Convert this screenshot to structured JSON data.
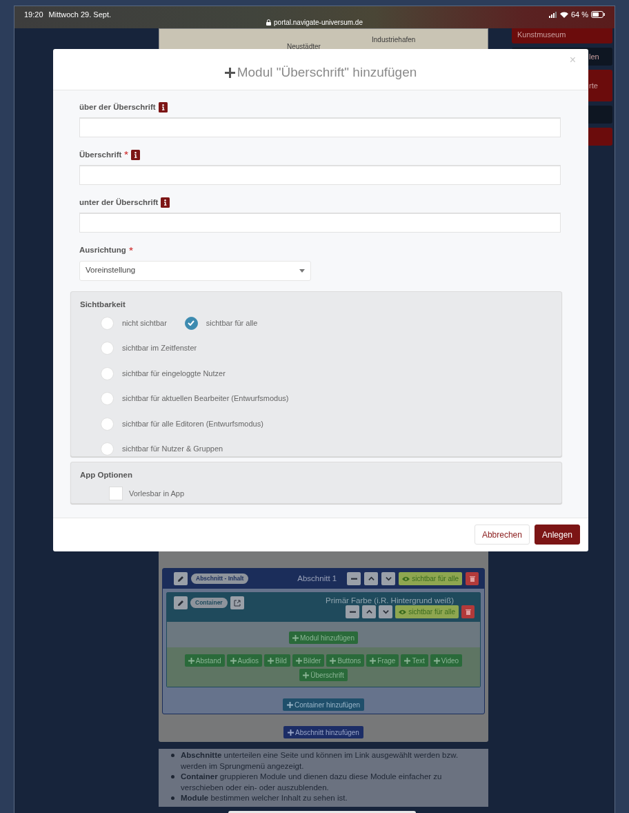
{
  "status_bar": {
    "time": "19:20",
    "date": "Mittwoch 29. Sept.",
    "url": "portal.navigate-universum.de",
    "battery": "64 %"
  },
  "map": {
    "labels": [
      "Neustädter",
      "Industriehafen"
    ]
  },
  "sidebar": [
    {
      "label": "Kunstmuseum",
      "kind": "red"
    },
    {
      "label": "len",
      "kind": "dark"
    },
    {
      "label": "rte",
      "kind": "red"
    },
    {
      "kind": "dark"
    },
    {
      "kind": "red"
    }
  ],
  "section": {
    "badge": "Abschnitt - Inhalt",
    "title": "Abschnitt 1",
    "visibility": "sichtbar für alle",
    "container": {
      "badge": "Container",
      "title": "Primär Farbe (i.R. Hintergrund weiß)",
      "visibility": "sichtbar für alle",
      "add_module": "Modul hinzufügen",
      "module_buttons": [
        "Abstand",
        "Audios",
        "Bild",
        "Bilder",
        "Buttons",
        "Frage",
        "Text",
        "Video",
        "Überschrift"
      ]
    },
    "add_container": "Container hinzufügen"
  },
  "add_section": "Abschnitt hinzufügen",
  "notes": [
    "**Abschnitte** unterteilen eine Seite und können im Link ausgewählt werden bzw. werden im Sprungmenü angezeigt.",
    "**Container** gruppieren Module und dienen dazu diese Module einfacher zu verschieben oder ein- oder auszublenden.",
    "**Module** bestimmen welcher Inhalt zu sehen ist."
  ],
  "modal": {
    "title": "Modul \"Überschrift\" hinzufügen",
    "close": "×",
    "fields": [
      {
        "label": "über der Überschrift",
        "required": false,
        "info": true
      },
      {
        "label": "Überschrift",
        "required": true,
        "info": true
      },
      {
        "label": "unter der Überschrift",
        "required": false,
        "info": true
      }
    ],
    "alignment": {
      "label": "Ausrichtung",
      "required": true,
      "value": "Voreinstellung"
    },
    "visibility": {
      "title": "Sichtbarkeit",
      "rows": [
        [
          {
            "label": "nicht sichtbar",
            "selected": false
          },
          {
            "label": "sichtbar für alle",
            "selected": true
          }
        ],
        [
          {
            "label": "sichtbar im Zeitfenster",
            "selected": false
          }
        ],
        [
          {
            "label": "sichtbar für eingeloggte Nutzer",
            "selected": false
          }
        ],
        [
          {
            "label": "sichtbar für aktuellen Bearbeiter (Entwurfsmodus)",
            "selected": false
          }
        ],
        [
          {
            "label": "sichtbar für alle Editoren (Entwurfsmodus)",
            "selected": false
          }
        ],
        [
          {
            "label": "sichtbar für Nutzer & Gruppen",
            "selected": false
          }
        ]
      ]
    },
    "app_options": {
      "title": "App Optionen",
      "options": [
        {
          "label": "Vorlesbar in App",
          "checked": false
        }
      ]
    },
    "buttons": [
      {
        "label": "Abbrechen",
        "kind": "secondary"
      },
      {
        "label": "Anlegen",
        "kind": "primary"
      }
    ]
  }
}
